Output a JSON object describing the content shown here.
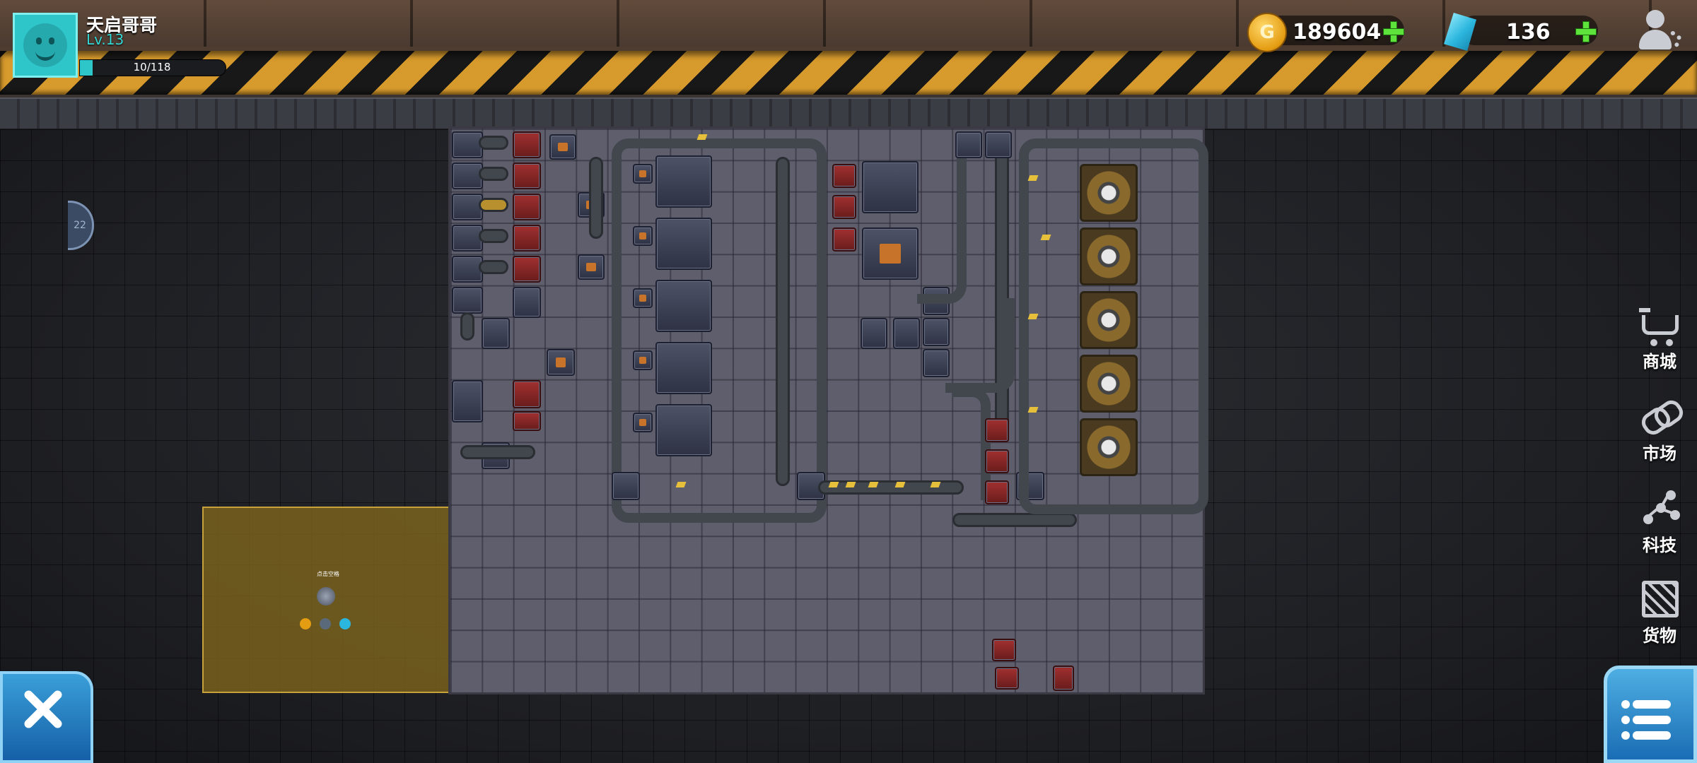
{
  "player": {
    "name": "天启哥哥",
    "level": "Lv.13",
    "xp_text": "10/118",
    "xp_fraction": 0.085
  },
  "currency": {
    "gold": "189604",
    "gems": "136",
    "gold_symbol": "G"
  },
  "side_tab": {
    "label": "22"
  },
  "selection_zone": {
    "label": "点击空格"
  },
  "right_menu": [
    {
      "label": "商城",
      "icon": "shopping-cart-icon"
    },
    {
      "label": "市场",
      "icon": "link-icon"
    },
    {
      "label": "科技",
      "icon": "tech-tree-icon"
    },
    {
      "label": "货物",
      "icon": "crate-icon"
    }
  ],
  "buttons": {
    "build_icon": "wrench-screwdriver-icon",
    "menu_icon": "list-menu-icon"
  },
  "colors": {
    "accent_cyan": "#2fc6c9",
    "gold": "#e49c12",
    "plus_green": "#5ee23c",
    "hazard_yellow": "#d79a2c",
    "button_blue": "#1a6db4",
    "selection_zone": "#82681e"
  }
}
